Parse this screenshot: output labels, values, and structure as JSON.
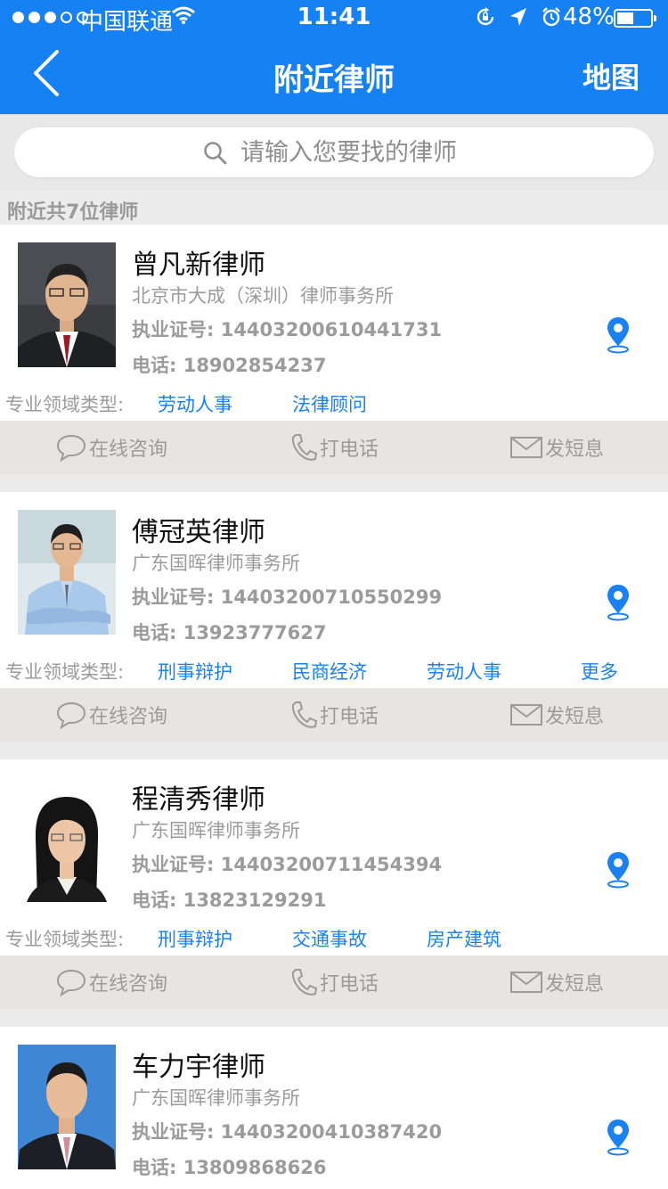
{
  "status_bar": {
    "carrier": "中国联通",
    "time": "11:41",
    "battery_percent": "48%",
    "battery_level": 0.48
  },
  "nav": {
    "title": "附近律师",
    "map_label": "地图",
    "back_icon": "chevron-left-icon"
  },
  "search": {
    "placeholder": "请输入您要找的律师",
    "value": ""
  },
  "count_text": "附近共7位律师",
  "fields_label": "专业领域类型:",
  "actions": {
    "consult": "在线咨询",
    "call": "打电话",
    "sms": "发短息"
  },
  "colors": {
    "primary": "#1581f3",
    "link": "#1a82f0",
    "muted_text": "#9b9b9b",
    "action_bar": "#e6e5e2"
  },
  "lawyers": [
    {
      "name": "曾凡新律师",
      "firm": "北京市大成（深圳）律师事务所",
      "license": "执业证号: 14403200610441731",
      "phone": "电话: 18902854237",
      "fields": [
        "劳动人事",
        "法律顾问"
      ]
    },
    {
      "name": "傅冠英律师",
      "firm": "广东国晖律师事务所",
      "license": "执业证号: 14403200710550299",
      "phone": "电话: 13923777627",
      "fields": [
        "刑事辩护",
        "民商经济",
        "劳动人事",
        "更多"
      ]
    },
    {
      "name": "程清秀律师",
      "firm": "广东国晖律师事务所",
      "license": "执业证号: 14403200711454394",
      "phone": "电话: 13823129291",
      "fields": [
        "刑事辩护",
        "交通事故",
        "房产建筑"
      ]
    },
    {
      "name": "车力宇律师",
      "firm": "广东国晖律师事务所",
      "license": "执业证号: 14403200410387420",
      "phone": "电话: 13809868626",
      "fields": []
    }
  ]
}
